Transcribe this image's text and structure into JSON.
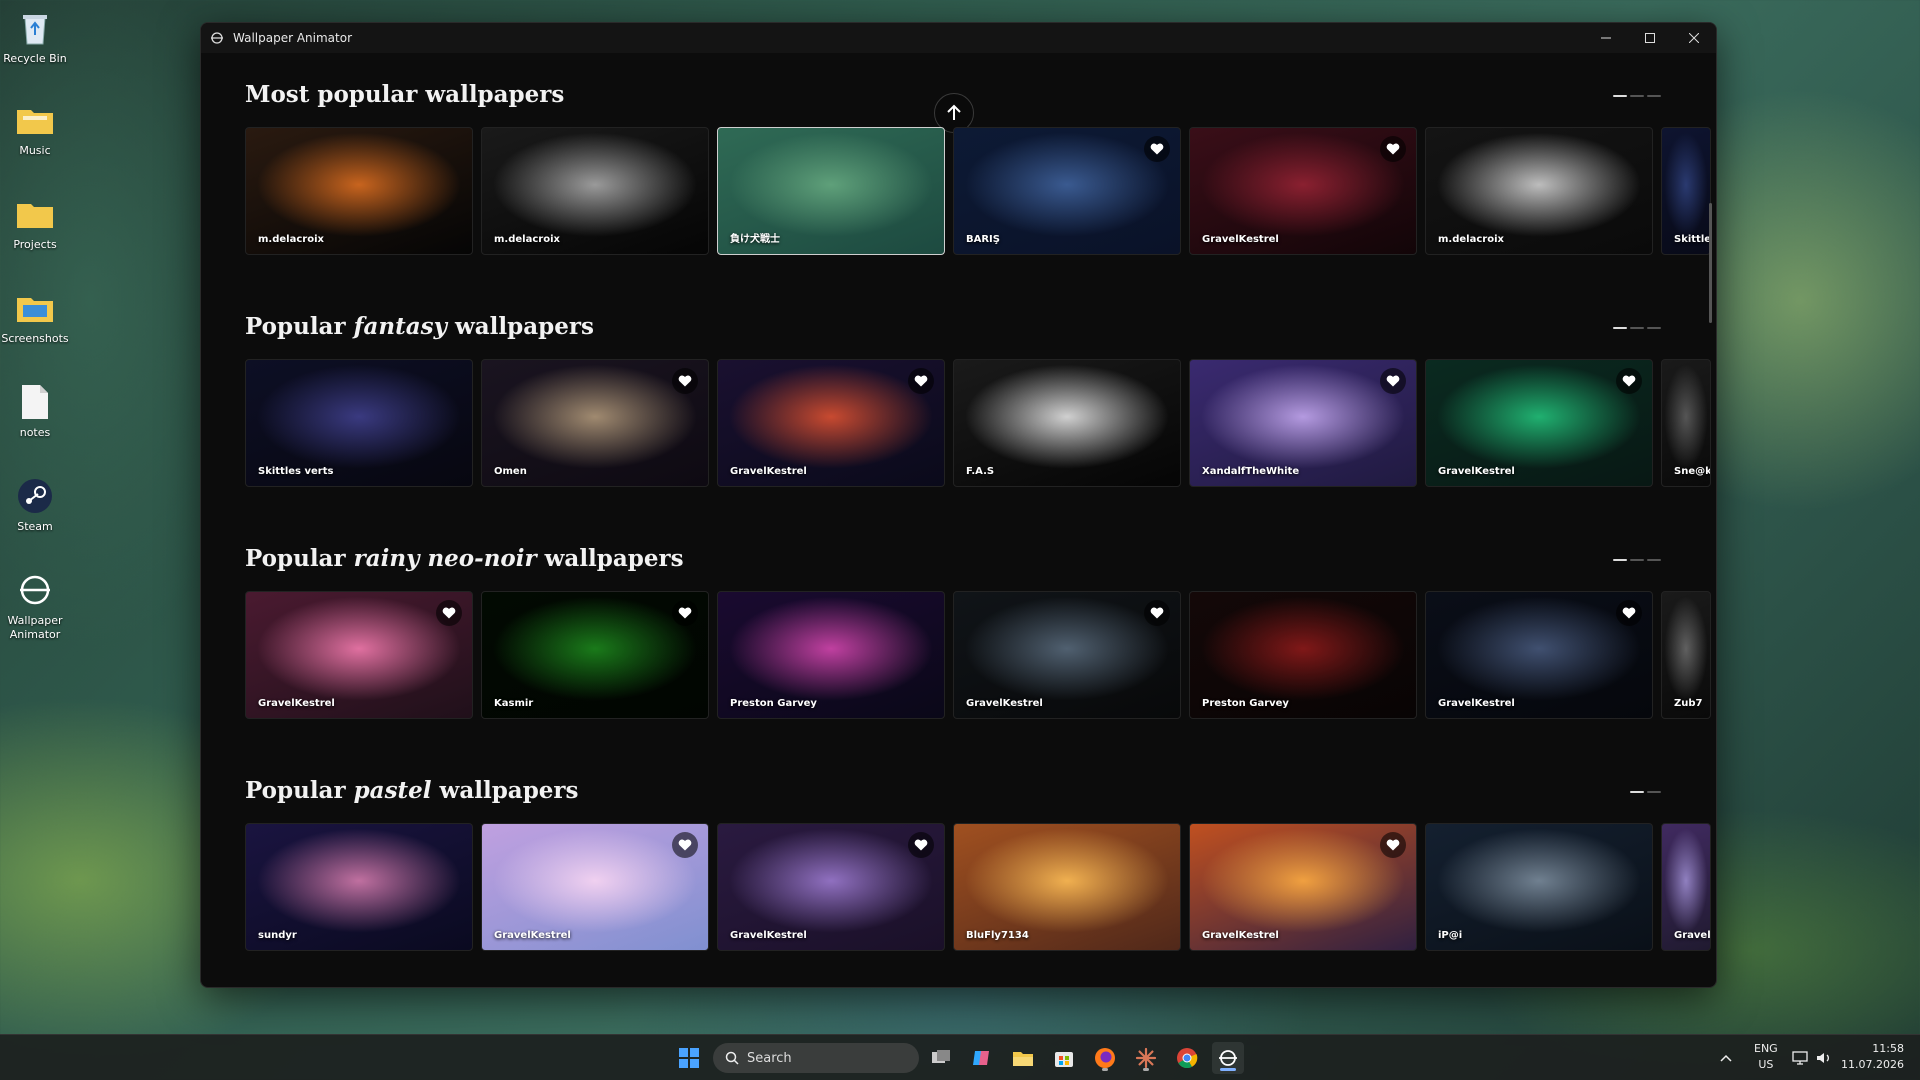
{
  "desktop": {
    "icons": [
      {
        "label": "Recycle Bin",
        "icon": "recycle-bin-icon"
      },
      {
        "label": "Music",
        "icon": "folder-icon"
      },
      {
        "label": "Projects",
        "icon": "folder-icon"
      },
      {
        "label": "Screenshots",
        "icon": "folder-icon"
      },
      {
        "label": "notes",
        "icon": "document-icon"
      },
      {
        "label": "Steam",
        "icon": "steam-icon"
      },
      {
        "label": "Wallpaper Animator",
        "icon": "wallpaper-animator-icon"
      }
    ]
  },
  "window": {
    "title": "Wallpaper Animator",
    "controls": [
      "minimize",
      "maximize",
      "close"
    ]
  },
  "sections": [
    {
      "title_prefix": "Most popular",
      "title_emph": "",
      "title_suffix": " wallpapers",
      "page_count": 3,
      "active_page": 0,
      "cards": [
        {
          "author": "m.delacroix",
          "fav": false,
          "colors": [
            "#2a1a10",
            "#c8641e",
            "#050505"
          ]
        },
        {
          "author": "m.delacroix",
          "fav": false,
          "colors": [
            "#1a1a1a",
            "#9a9a9a",
            "#050505"
          ]
        },
        {
          "author": "負け犬戦士",
          "fav": false,
          "selected": true,
          "colors": [
            "#2f6a55",
            "#5fa07a",
            "#1d4a40"
          ]
        },
        {
          "author": "BARIŞ",
          "fav": true,
          "colors": [
            "#0d1a35",
            "#3a5a90",
            "#0a1228"
          ]
        },
        {
          "author": "GravelKestrel",
          "fav": true,
          "colors": [
            "#3a0e18",
            "#8a2030",
            "#120508"
          ]
        },
        {
          "author": "m.delacroix",
          "fav": false,
          "colors": [
            "#141414",
            "#bdbdbd",
            "#0a0a0a"
          ]
        },
        {
          "author": "Skittles",
          "fav": false,
          "narrow": true,
          "colors": [
            "#0e1430",
            "#2a3a70",
            "#080a18"
          ]
        }
      ]
    },
    {
      "title_prefix": "Popular ",
      "title_emph": "fantasy",
      "title_suffix": " wallpapers",
      "page_count": 3,
      "active_page": 0,
      "cards": [
        {
          "author": "Skittles verts",
          "fav": false,
          "colors": [
            "#0d0f25",
            "#3a3a80",
            "#070710"
          ]
        },
        {
          "author": "Omen",
          "fav": true,
          "colors": [
            "#1a1420",
            "#a08a70",
            "#0e0a12"
          ]
        },
        {
          "author": "GravelKestrel",
          "fav": true,
          "colors": [
            "#1a1030",
            "#c84a30",
            "#0a0a1a"
          ]
        },
        {
          "author": "F.A.S",
          "fav": false,
          "colors": [
            "#1a1a1a",
            "#d0d0d0",
            "#050505"
          ]
        },
        {
          "author": "XandalfTheWhite",
          "fav": true,
          "colors": [
            "#3a2a70",
            "#b49ae0",
            "#201a40"
          ]
        },
        {
          "author": "GravelKestrel",
          "fav": true,
          "colors": [
            "#0a2a20",
            "#20b070",
            "#081814"
          ]
        },
        {
          "author": "Sne@k",
          "fav": false,
          "narrow": true,
          "colors": [
            "#1a1a1a",
            "#555",
            "#0a0a0a"
          ]
        }
      ]
    },
    {
      "title_prefix": "Popular ",
      "title_emph": "rainy neo-noir",
      "title_suffix": " wallpapers",
      "page_count": 3,
      "active_page": 0,
      "cards": [
        {
          "author": "GravelKestrel",
          "fav": true,
          "colors": [
            "#4a1a30",
            "#e070a0",
            "#20101a"
          ]
        },
        {
          "author": "Kasmir",
          "fav": true,
          "colors": [
            "#020a02",
            "#1a7a1a",
            "#010501"
          ]
        },
        {
          "author": "Preston Garvey",
          "fav": false,
          "colors": [
            "#1a0a30",
            "#c040a0",
            "#0a0818"
          ]
        },
        {
          "author": "GravelKestrel",
          "fav": true,
          "colors": [
            "#101418",
            "#506070",
            "#08090a"
          ]
        },
        {
          "author": "Preston Garvey",
          "fav": false,
          "colors": [
            "#140808",
            "#801818",
            "#080404"
          ]
        },
        {
          "author": "GravelKestrel",
          "fav": true,
          "colors": [
            "#0a0e18",
            "#405070",
            "#05070c"
          ]
        },
        {
          "author": "Zub7",
          "fav": false,
          "narrow": true,
          "colors": [
            "#1a1a1a",
            "#606060",
            "#0a0a0a"
          ]
        }
      ]
    },
    {
      "title_prefix": "Popular ",
      "title_emph": "pastel",
      "title_suffix": " wallpapers",
      "page_count": 2,
      "active_page": 0,
      "cards": [
        {
          "author": "sundyr",
          "fav": false,
          "colors": [
            "#1a1440",
            "#c070a0",
            "#0a0a20"
          ]
        },
        {
          "author": "GravelKestrel",
          "fav": true,
          "colors": [
            "#c0a0e0",
            "#f0d0f0",
            "#8090d0"
          ]
        },
        {
          "author": "GravelKestrel",
          "fav": true,
          "colors": [
            "#2a1a40",
            "#9070c0",
            "#1a1028"
          ]
        },
        {
          "author": "BluFly7134",
          "fav": false,
          "colors": [
            "#a05020",
            "#f0b050",
            "#50281a"
          ]
        },
        {
          "author": "GravelKestrel",
          "fav": true,
          "colors": [
            "#c05020",
            "#f0a040",
            "#302040"
          ]
        },
        {
          "author": "iP@i",
          "fav": false,
          "colors": [
            "#142030",
            "#708090",
            "#0a1018"
          ]
        },
        {
          "author": "Gravel",
          "fav": false,
          "narrow": true,
          "colors": [
            "#402a60",
            "#9080c0",
            "#201a30"
          ]
        }
      ]
    }
  ],
  "taskbar": {
    "search_placeholder": "Search",
    "lang_top": "ENG",
    "lang_bottom": "US",
    "time": "11:58",
    "date": "11.07.2026",
    "apps": [
      "start-icon",
      "task-view-icon",
      "copilot-icon",
      "file-explorer-icon",
      "store-icon",
      "firefox-icon",
      "claude-icon",
      "chrome-icon",
      "wallpaper-animator-icon"
    ]
  }
}
